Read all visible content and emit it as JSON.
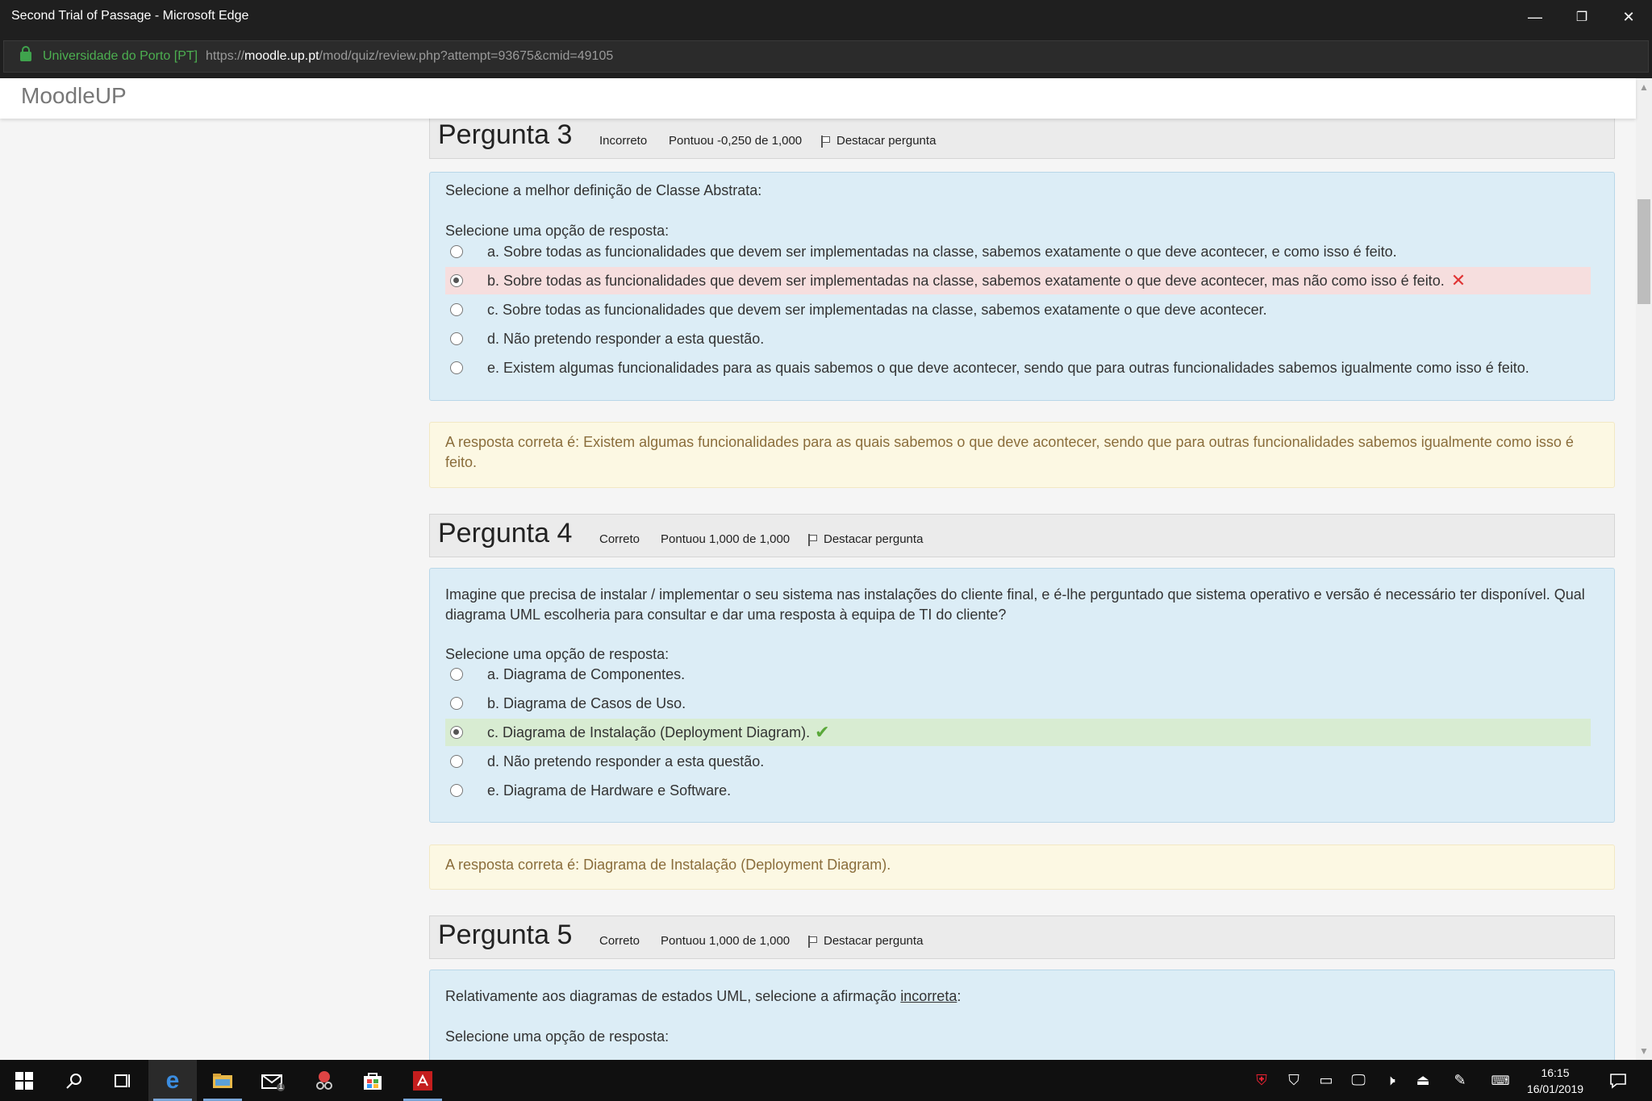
{
  "window": {
    "title": "Second Trial of Passage - Microsoft Edge",
    "minimize": "—",
    "restore": "❐",
    "close": "✕"
  },
  "address": {
    "site_identity": "Universidade do Porto [PT]",
    "url_prefix": "https://",
    "url_domain": "moodle.up.pt",
    "url_path": "/mod/quiz/review.php?attempt=93675&cmid=49105"
  },
  "header": {
    "brand": "MoodleUP"
  },
  "questions": [
    {
      "title": "Pergunta 3",
      "state": "Incorreto",
      "grade": "Pontuou -0,250 de 1,000",
      "flag_label": "Destacar pergunta",
      "text": "Selecione a melhor definição de Classe Abstrata:",
      "prompt": "Selecione uma opção de resposta:",
      "options": [
        "a. Sobre todas as funcionalidades que devem ser implementadas na classe, sabemos exatamente o que deve acontecer, e como isso é feito.",
        "b. Sobre todas as funcionalidades que devem ser implementadas na classe, sabemos exatamente o que deve acontecer, mas não como isso é feito.",
        "c. Sobre todas as funcionalidades que devem ser implementadas na classe, sabemos exatamente o que deve acontecer.",
        "d. Não pretendo responder a esta questão.",
        "e. Existem algumas funcionalidades para as quais sabemos o que deve acontecer, sendo que para outras funcionalidades sabemos igualmente como isso é feito."
      ],
      "selected": "b",
      "result_mark": "✕",
      "feedback": "A resposta correta é: Existem algumas funcionalidades para as quais sabemos o que deve acontecer, sendo que para outras funcionalidades sabemos igualmente como isso é feito."
    },
    {
      "title": "Pergunta 4",
      "state": "Correto",
      "grade": "Pontuou 1,000 de 1,000",
      "flag_label": "Destacar pergunta",
      "text": "Imagine que precisa de instalar / implementar o seu sistema nas instalações do cliente final, e é-lhe perguntado que sistema operativo e versão é necessário ter disponível. Qual diagrama UML escolheria para consultar e dar uma resposta à equipa de TI do cliente?",
      "prompt": "Selecione uma opção de resposta:",
      "options": [
        "a. Diagrama de Componentes.",
        "b. Diagrama de Casos de Uso.",
        "c. Diagrama de Instalação (Deployment Diagram).",
        "d. Não pretendo responder a esta questão.",
        "e. Diagrama de Hardware e Software."
      ],
      "selected": "c",
      "result_mark": "✔",
      "feedback": "A resposta correta é: Diagrama de Instalação (Deployment Diagram)."
    },
    {
      "title": "Pergunta 5",
      "state": "Correto",
      "grade": "Pontuou 1,000 de 1,000",
      "flag_label": "Destacar pergunta",
      "text_before": "Relativamente aos diagramas de estados UML, selecione a afirmação ",
      "text_emphasis": "incorreta",
      "text_after": ":",
      "prompt": "Selecione uma opção de resposta:"
    }
  ],
  "taskbar": {
    "time": "16:15",
    "date": "16/01/2019",
    "mail_badge": "1"
  }
}
